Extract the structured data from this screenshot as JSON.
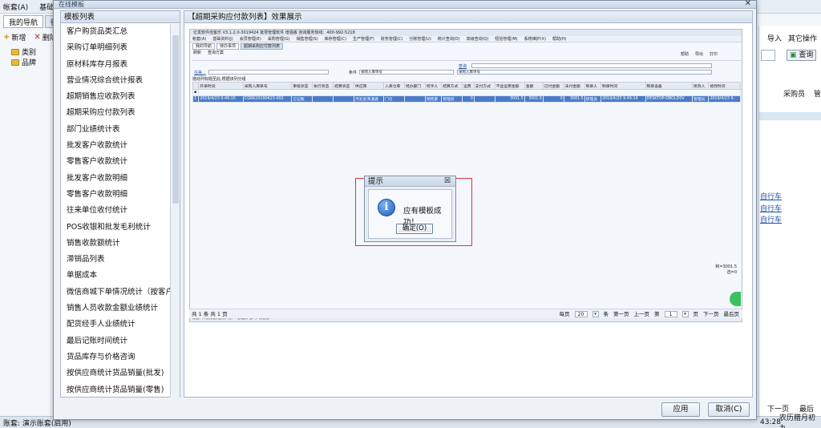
{
  "background_app": {
    "menu": [
      "帐套(A)",
      "基础资料"
    ],
    "tabs": [
      "我的导航",
      "待"
    ],
    "toolbar": {
      "add": "新增",
      "delete": "删除"
    },
    "tree": [
      "类别",
      "品牌"
    ],
    "right": {
      "import": "导入",
      "other_ops": "其它操作",
      "query": "查询",
      "col_buyer": "采购员",
      "col_manage": "管",
      "links": [
        "自行车",
        "自行车",
        "自行车"
      ],
      "next_page": "下一页",
      "last_page": "最后"
    },
    "status": {
      "account": "账套: 演示账套(启用)",
      "lunar": "农历腊月初九",
      "time": "43:28"
    }
  },
  "modal": {
    "title": "在线模板",
    "template_panel_title": "模板列表",
    "templates": [
      "客户购货品类汇总",
      "采购订单明细列表",
      "原材料库存月报表",
      "营业情况综合统计报表",
      "超期销售应收款列表",
      "超期采购应付款列表",
      "部门业绩统计表",
      "批发客户收款统计",
      "零售客户收款统计",
      "批发客户收款明细",
      "零售客户收款明细",
      "往来单位收付统计",
      "POS收银和批发毛利统计",
      "销售收款额统计",
      "滞销品列表",
      "单据成本",
      "微信商城下单情况统计（按客户）",
      "销售人员收款金额业绩统计",
      "配货经手人业绩统计",
      "最后记账时间统计",
      "货品库存与价格咨询",
      "按供应商统计货品销量(批发)",
      "按供应商统计货品销量(零售)"
    ],
    "preview_title": "【超期采购应付款列表】效果展示",
    "preview": {
      "window_title": "亿发软件佳客乐 V3.1.2.0-3019424 批零管理软件 增强版 咨询服务热线：400-992-5218",
      "menu": [
        "帐套(A)",
        "基础资料(J)",
        "会员管理(E)",
        "采购管理(G)",
        "销售管理(S)",
        "库存管理(C)",
        "生产管理(F)",
        "财务管理(C)",
        "分账管理(U)",
        "统计查询(D)",
        "高级查询(Q)",
        "短信管理(M)",
        "系统维护(X)",
        "帮助(H)"
      ],
      "tabs": [
        "我的导航",
        "待办事项",
        "超期采购应付款列表"
      ],
      "toolbar": [
        "刷新",
        "查询方案"
      ],
      "toolbar_right": [
        "帮助",
        "导出",
        "打印"
      ],
      "filter": {
        "supplier_label": "往来...",
        "query_label": "查询",
        "condition_label": "条件",
        "doc_no_label": "采购入库单号",
        "purchase_no_label": "采购入库单号"
      },
      "hint": "拖动列标题至此,根据该列分组",
      "columns": [
        "开单时间",
        "采购入库单号",
        "审核状态",
        "执行状态",
        "结算状态",
        "供应商",
        "入库仓库",
        "经办部门",
        "经手人",
        "结算方式",
        "运费",
        "支付方式",
        "不含运费金额",
        "金额",
        "已付金额",
        "未付金额",
        "制单人",
        "制单时间",
        "制单设备",
        "修改人",
        "修改时间"
      ],
      "row": {
        "idx": "1",
        "time": "2019/4/23 9:49:15",
        "doc_no": "CGRK20190423-002",
        "audit": "已记账",
        "supplier": "河北安泽通通",
        "warehouse": "门仓",
        "dept": "销售部",
        "handler": "管理员",
        "freight": "0",
        "amount_ex": "3001.5",
        "amount": "3001.5",
        "paid": "0",
        "unpaid": "3001.5",
        "maker": "管理员",
        "make_time": "2019/4/23 9:49:14",
        "device": "DESKTOP-DBOLD0V",
        "modifier": "管理员",
        "modify_time": "2019/4/23 9:"
      },
      "totals": [
        "和=3001.5",
        "选=0"
      ],
      "pager": {
        "summary": "共 1 条  共 1 页",
        "per_page_label": "每页",
        "per_page": "20",
        "unit": "条",
        "first": "第一页",
        "prev": "上一页",
        "page_prefix": "第",
        "page": "1",
        "page_suffix": "页",
        "next": "下一页",
        "last": "最后页"
      },
      "status": "账套: 开发账套(启用)   用户: 管理员  部门: 销售部"
    },
    "dialog": {
      "title": "提示",
      "message": "应有模板成功！",
      "ok": "确定(O)"
    },
    "buttons": {
      "apply": "应用",
      "cancel": "取消(C)"
    }
  }
}
